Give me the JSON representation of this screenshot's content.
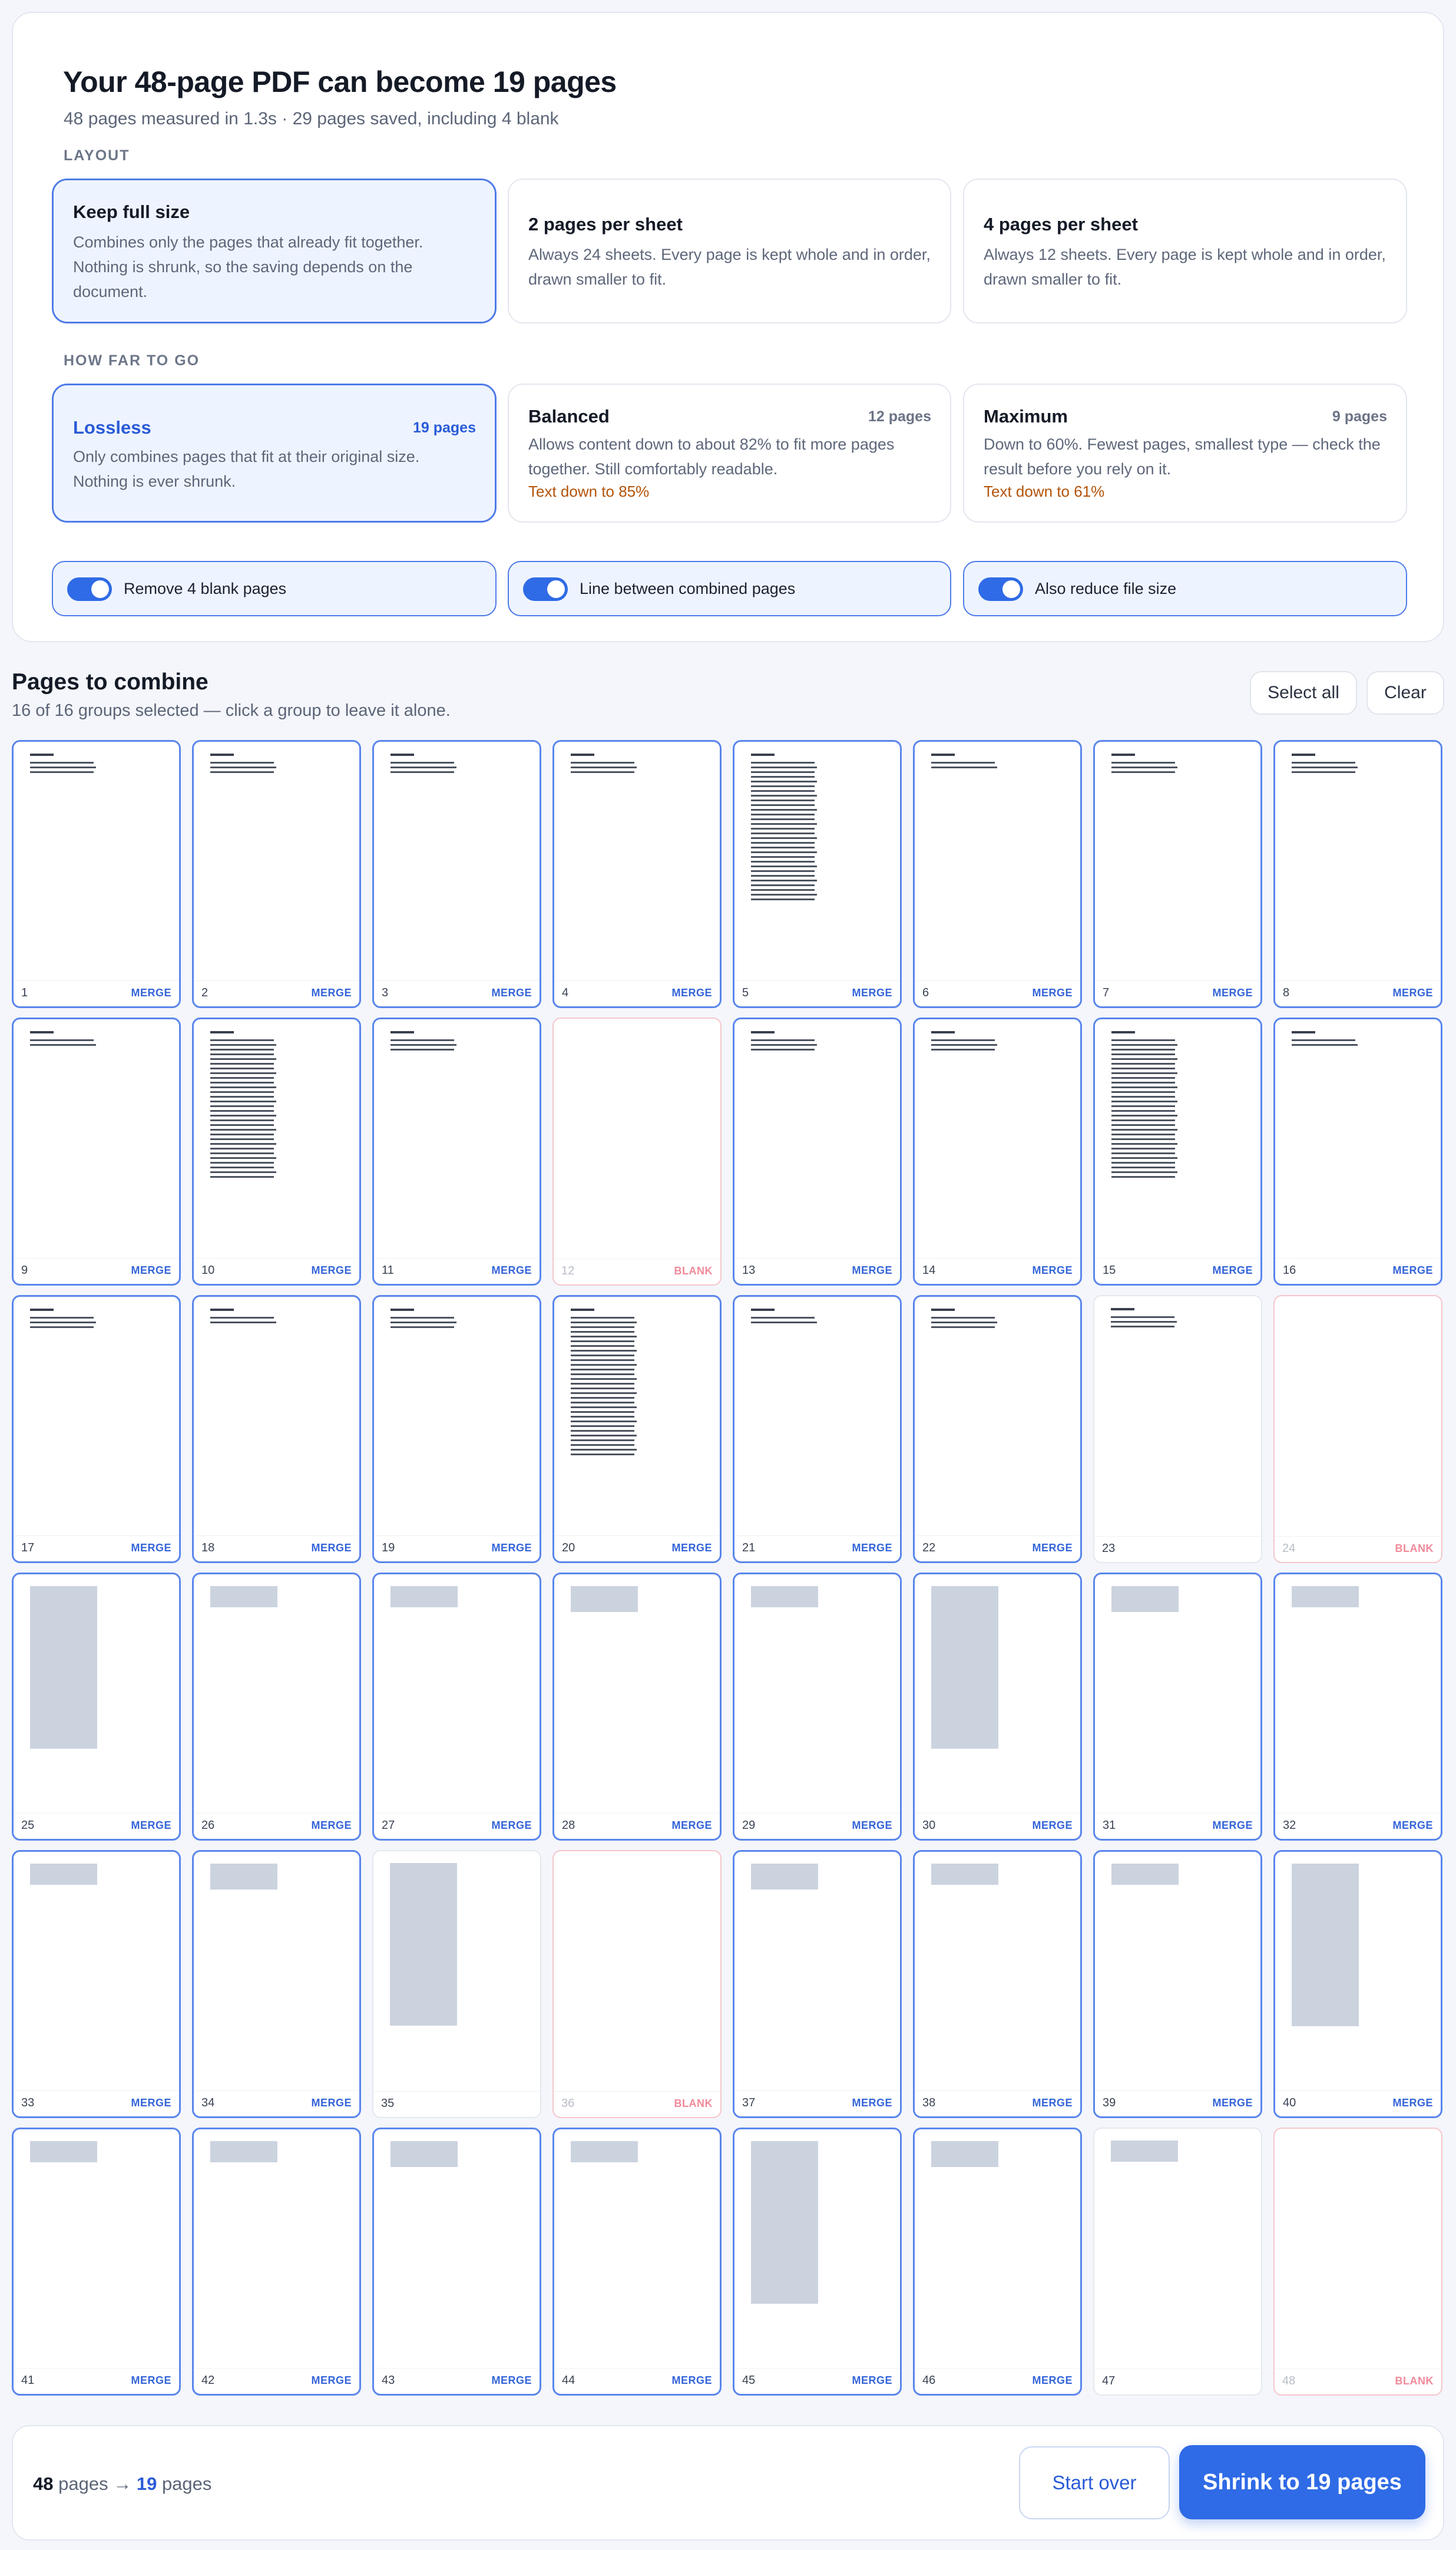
{
  "header": {
    "title": "Your 48-page PDF can become 19 pages",
    "subtitle": "48 pages measured in 1.3s · 29 pages saved, including 4 blank"
  },
  "layout": {
    "label": "LAYOUT",
    "options": [
      {
        "title": "Keep full size",
        "desc": "Combines only the pages that already fit together. Nothing is shrunk, so the saving depends on the document.",
        "selected": true
      },
      {
        "title": "2 pages per sheet",
        "desc": "Always 24 sheets. Every page is kept whole and in order, drawn smaller to fit.",
        "selected": false
      },
      {
        "title": "4 pages per sheet",
        "desc": "Always 12 sheets. Every page is kept whole and in order, drawn smaller to fit.",
        "selected": false
      }
    ]
  },
  "how_far": {
    "label": "HOW FAR TO GO",
    "options": [
      {
        "title": "Lossless",
        "pages": "19 pages",
        "desc": "Only combines pages that fit at their original size. Nothing is ever shrunk.",
        "warn": "",
        "selected": true
      },
      {
        "title": "Balanced",
        "pages": "12 pages",
        "desc": "Allows content down to about 82% to fit more pages together. Still comfortably readable.",
        "warn": "Text down to 85%",
        "selected": false
      },
      {
        "title": "Maximum",
        "pages": "9 pages",
        "desc": "Down to 60%. Fewest pages, smallest type — check the result before you rely on it.",
        "warn": "Text down to 61%",
        "selected": false
      }
    ]
  },
  "toggles": [
    {
      "label": "Remove 4 blank pages",
      "on": true
    },
    {
      "label": "Line between combined pages",
      "on": true
    },
    {
      "label": "Also reduce file size",
      "on": true
    }
  ],
  "pages_section": {
    "title": "Pages to combine",
    "subtitle": "16 of 16 groups selected — click a group to leave it alone.",
    "select_all": "Select all",
    "clear": "Clear"
  },
  "tags": {
    "merge": "MERGE",
    "blank": "BLANK"
  },
  "pages": [
    {
      "n": "1",
      "s": "merge",
      "c": "text",
      "lines": 3
    },
    {
      "n": "2",
      "s": "merge",
      "c": "text",
      "lines": 3
    },
    {
      "n": "3",
      "s": "merge",
      "c": "text",
      "lines": 3
    },
    {
      "n": "4",
      "s": "merge",
      "c": "text",
      "lines": 3
    },
    {
      "n": "5",
      "s": "merge",
      "c": "text",
      "lines": 30
    },
    {
      "n": "6",
      "s": "merge",
      "c": "text",
      "lines": 2
    },
    {
      "n": "7",
      "s": "merge",
      "c": "text",
      "lines": 3
    },
    {
      "n": "8",
      "s": "merge",
      "c": "text",
      "lines": 3
    },
    {
      "n": "9",
      "s": "merge",
      "c": "text",
      "lines": 2
    },
    {
      "n": "10",
      "s": "merge",
      "c": "text",
      "lines": 30
    },
    {
      "n": "11",
      "s": "merge",
      "c": "text",
      "lines": 3
    },
    {
      "n": "12",
      "s": "blank",
      "c": "none",
      "lines": 0
    },
    {
      "n": "13",
      "s": "merge",
      "c": "text",
      "lines": 3
    },
    {
      "n": "14",
      "s": "merge",
      "c": "text",
      "lines": 3
    },
    {
      "n": "15",
      "s": "merge",
      "c": "text",
      "lines": 30
    },
    {
      "n": "16",
      "s": "merge",
      "c": "text",
      "lines": 2
    },
    {
      "n": "17",
      "s": "merge",
      "c": "text",
      "lines": 3
    },
    {
      "n": "18",
      "s": "merge",
      "c": "text",
      "lines": 2
    },
    {
      "n": "19",
      "s": "merge",
      "c": "text",
      "lines": 3
    },
    {
      "n": "20",
      "s": "merge",
      "c": "text",
      "lines": 30
    },
    {
      "n": "21",
      "s": "merge",
      "c": "text",
      "lines": 2
    },
    {
      "n": "22",
      "s": "merge",
      "c": "text",
      "lines": 3
    },
    {
      "n": "23",
      "s": "off",
      "c": "text",
      "lines": 3
    },
    {
      "n": "24",
      "s": "blank",
      "c": "none",
      "lines": 0
    },
    {
      "n": "25",
      "s": "merge",
      "c": "tall",
      "lines": 0
    },
    {
      "n": "26",
      "s": "merge",
      "c": "short",
      "lines": 0
    },
    {
      "n": "27",
      "s": "merge",
      "c": "short",
      "lines": 0
    },
    {
      "n": "28",
      "s": "merge",
      "c": "short",
      "lines": 0
    },
    {
      "n": "29",
      "s": "merge",
      "c": "short",
      "lines": 0
    },
    {
      "n": "30",
      "s": "merge",
      "c": "tall",
      "lines": 0
    },
    {
      "n": "31",
      "s": "merge",
      "c": "short",
      "lines": 0
    },
    {
      "n": "32",
      "s": "merge",
      "c": "short",
      "lines": 0
    },
    {
      "n": "33",
      "s": "merge",
      "c": "short",
      "lines": 0
    },
    {
      "n": "34",
      "s": "merge",
      "c": "short",
      "lines": 0
    },
    {
      "n": "35",
      "s": "off",
      "c": "tall",
      "lines": 0
    },
    {
      "n": "36",
      "s": "blank",
      "c": "none",
      "lines": 0
    },
    {
      "n": "37",
      "s": "merge",
      "c": "short",
      "lines": 0
    },
    {
      "n": "38",
      "s": "merge",
      "c": "short",
      "lines": 0
    },
    {
      "n": "39",
      "s": "merge",
      "c": "short",
      "lines": 0
    },
    {
      "n": "40",
      "s": "merge",
      "c": "tall",
      "lines": 0
    },
    {
      "n": "41",
      "s": "merge",
      "c": "short",
      "lines": 0
    },
    {
      "n": "42",
      "s": "merge",
      "c": "short",
      "lines": 0
    },
    {
      "n": "43",
      "s": "merge",
      "c": "short",
      "lines": 0
    },
    {
      "n": "44",
      "s": "merge",
      "c": "short",
      "lines": 0
    },
    {
      "n": "45",
      "s": "merge",
      "c": "tall",
      "lines": 0
    },
    {
      "n": "46",
      "s": "merge",
      "c": "short",
      "lines": 0
    },
    {
      "n": "47",
      "s": "off",
      "c": "short",
      "lines": 0
    },
    {
      "n": "48",
      "s": "blank",
      "c": "none",
      "lines": 0
    }
  ],
  "footer": {
    "before": "48",
    "pages_word": "pages",
    "arrow": "→",
    "after": "19",
    "pages_word2": "pages",
    "start_over": "Start over",
    "shrink": "Shrink to 19 pages"
  }
}
